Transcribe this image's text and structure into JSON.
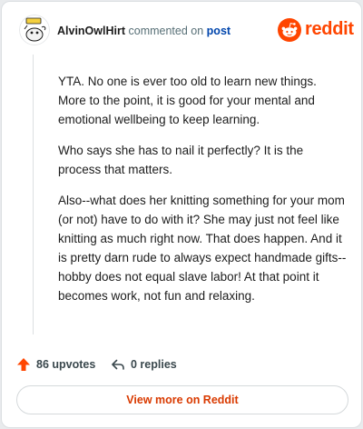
{
  "header": {
    "author": "AlvinOwlHirt",
    "commented_text": "commented on",
    "post_link": "post",
    "brand": "reddit"
  },
  "comment": {
    "paragraphs": [
      "YTA. No one is ever too old to learn new things. More to the point, it is good for your mental and emotional wellbeing to keep learning.",
      "Who says she has to nail it perfectly? It is the process that matters.",
      "Also--what does her knitting something for your mom (or not) have to do with it? She may just not feel like knitting as much right now. That does happen. And it is pretty darn rude to always expect handmade gifts--hobby does not equal slave labor! At that point it becomes work, not fun and relaxing."
    ]
  },
  "actions": {
    "upvotes": "86 upvotes",
    "replies": "0 replies"
  },
  "footer": {
    "view_more": "View more on Reddit"
  },
  "colors": {
    "brand": "#ff4500",
    "link": "#0045ac",
    "view_more": "#d93a00"
  },
  "icons": {
    "avatar": "snoo-avatar",
    "brand": "reddit-snoo-logo",
    "upvote": "upvote-arrow-icon",
    "reply": "reply-arrow-icon"
  }
}
